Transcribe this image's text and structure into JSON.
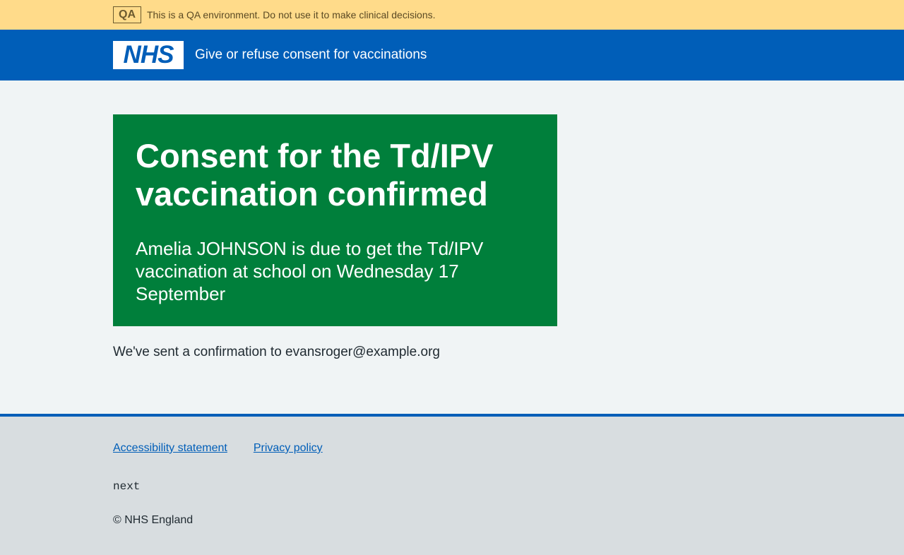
{
  "qa_banner": {
    "tag": "QA",
    "message": "This is a QA environment. Do not use it to make clinical decisions."
  },
  "header": {
    "logo_text": "NHS",
    "service_name": "Give or refuse consent for vaccinations"
  },
  "panel": {
    "title": "Consent for the Td/IPV vaccination confirmed",
    "body": "Amelia JOHNSON is due to get the Td/IPV vaccination at school on Wednesday 17 September"
  },
  "confirmation": "We've sent a confirmation to evansroger@example.org",
  "footer": {
    "links": [
      "Accessibility statement",
      "Privacy policy"
    ],
    "version": "next",
    "copyright": "© NHS England"
  },
  "colors": {
    "brand_blue": "#005eb8",
    "success_green": "#007f3b",
    "qa_yellow": "#ffdb8a"
  }
}
